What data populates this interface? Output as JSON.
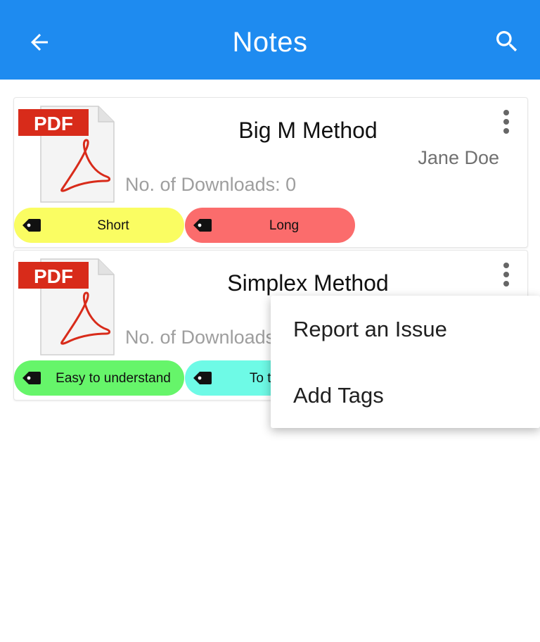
{
  "appbar": {
    "title": "Notes",
    "back_icon": "arrow-back-icon",
    "search_icon": "search-icon",
    "color": "#1e8bf0"
  },
  "notes": [
    {
      "title": "Big M Method",
      "author": "Jane Doe",
      "downloads": "No. of Downloads: 0",
      "file_badge": "PDF",
      "tags": [
        {
          "label": "Short",
          "color": "#fafd62"
        },
        {
          "label": "Long",
          "color": "#fb6c6c"
        }
      ]
    },
    {
      "title": "Simplex Method",
      "downloads": "No. of Downloads: 0",
      "file_badge": "PDF",
      "tags": [
        {
          "label": "Easy to understand",
          "color": "#66f56a"
        },
        {
          "label": "To the point",
          "color": "#6efae6"
        }
      ]
    }
  ],
  "popup_menu": {
    "items": [
      "Report an Issue",
      "Add Tags"
    ]
  }
}
